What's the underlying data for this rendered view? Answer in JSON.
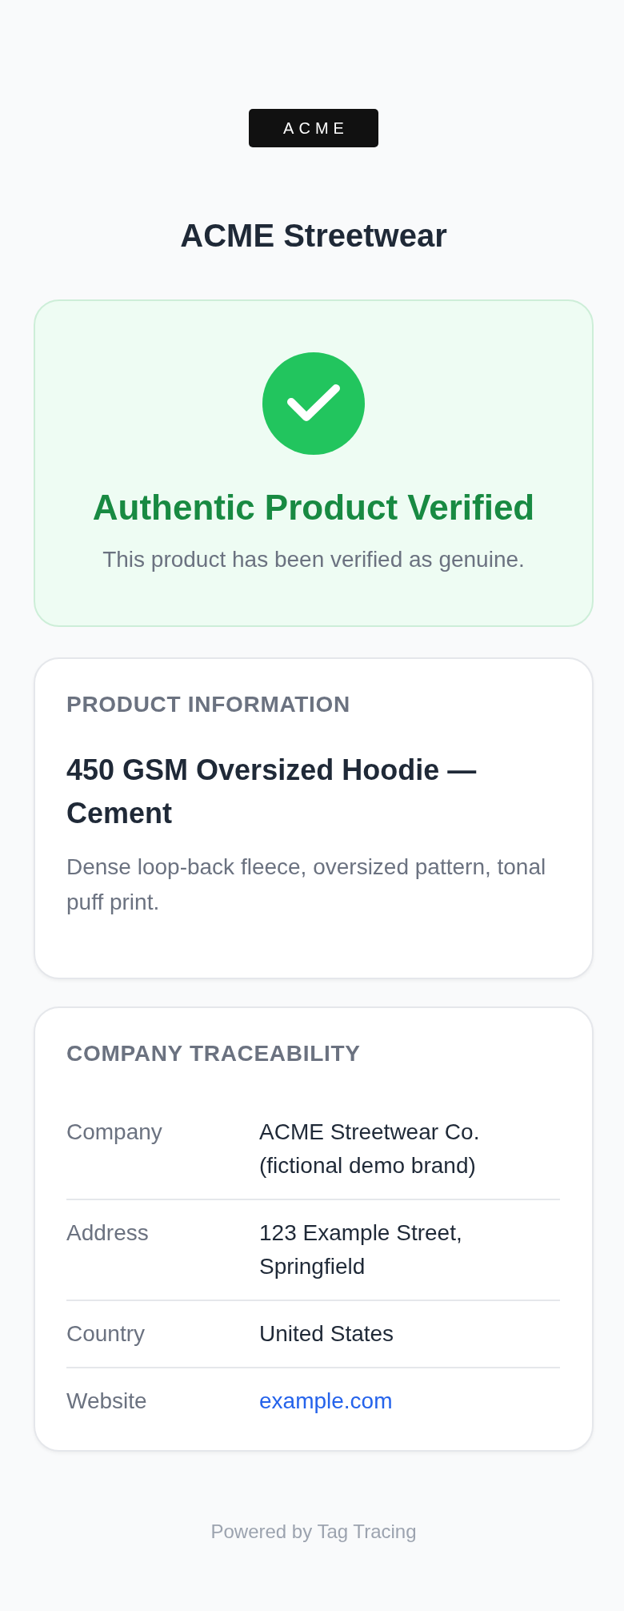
{
  "logo": {
    "text": "ACME"
  },
  "brand_name": "ACME Streetwear",
  "verification": {
    "verified": true,
    "title": "Authentic Product Verified",
    "message": "This product has been verified as genuine."
  },
  "product_information": {
    "heading": "PRODUCT INFORMATION",
    "name": "450 GSM Oversized Hoodie — Cement",
    "description": "Dense loop-back fleece, oversized pattern, tonal puff print."
  },
  "company_traceability": {
    "heading": "COMPANY TRACEABILITY",
    "rows": [
      {
        "label": "Company",
        "value": "ACME Streetwear Co. (fictional demo brand)",
        "kind": "text"
      },
      {
        "label": "Address",
        "value": "123 Example Street, Springfield",
        "kind": "text"
      },
      {
        "label": "Country",
        "value": "United States",
        "kind": "text"
      },
      {
        "label": "Website",
        "value": "example.com",
        "kind": "link"
      }
    ]
  },
  "footer": {
    "text": "Powered by Tag Tracing"
  }
}
